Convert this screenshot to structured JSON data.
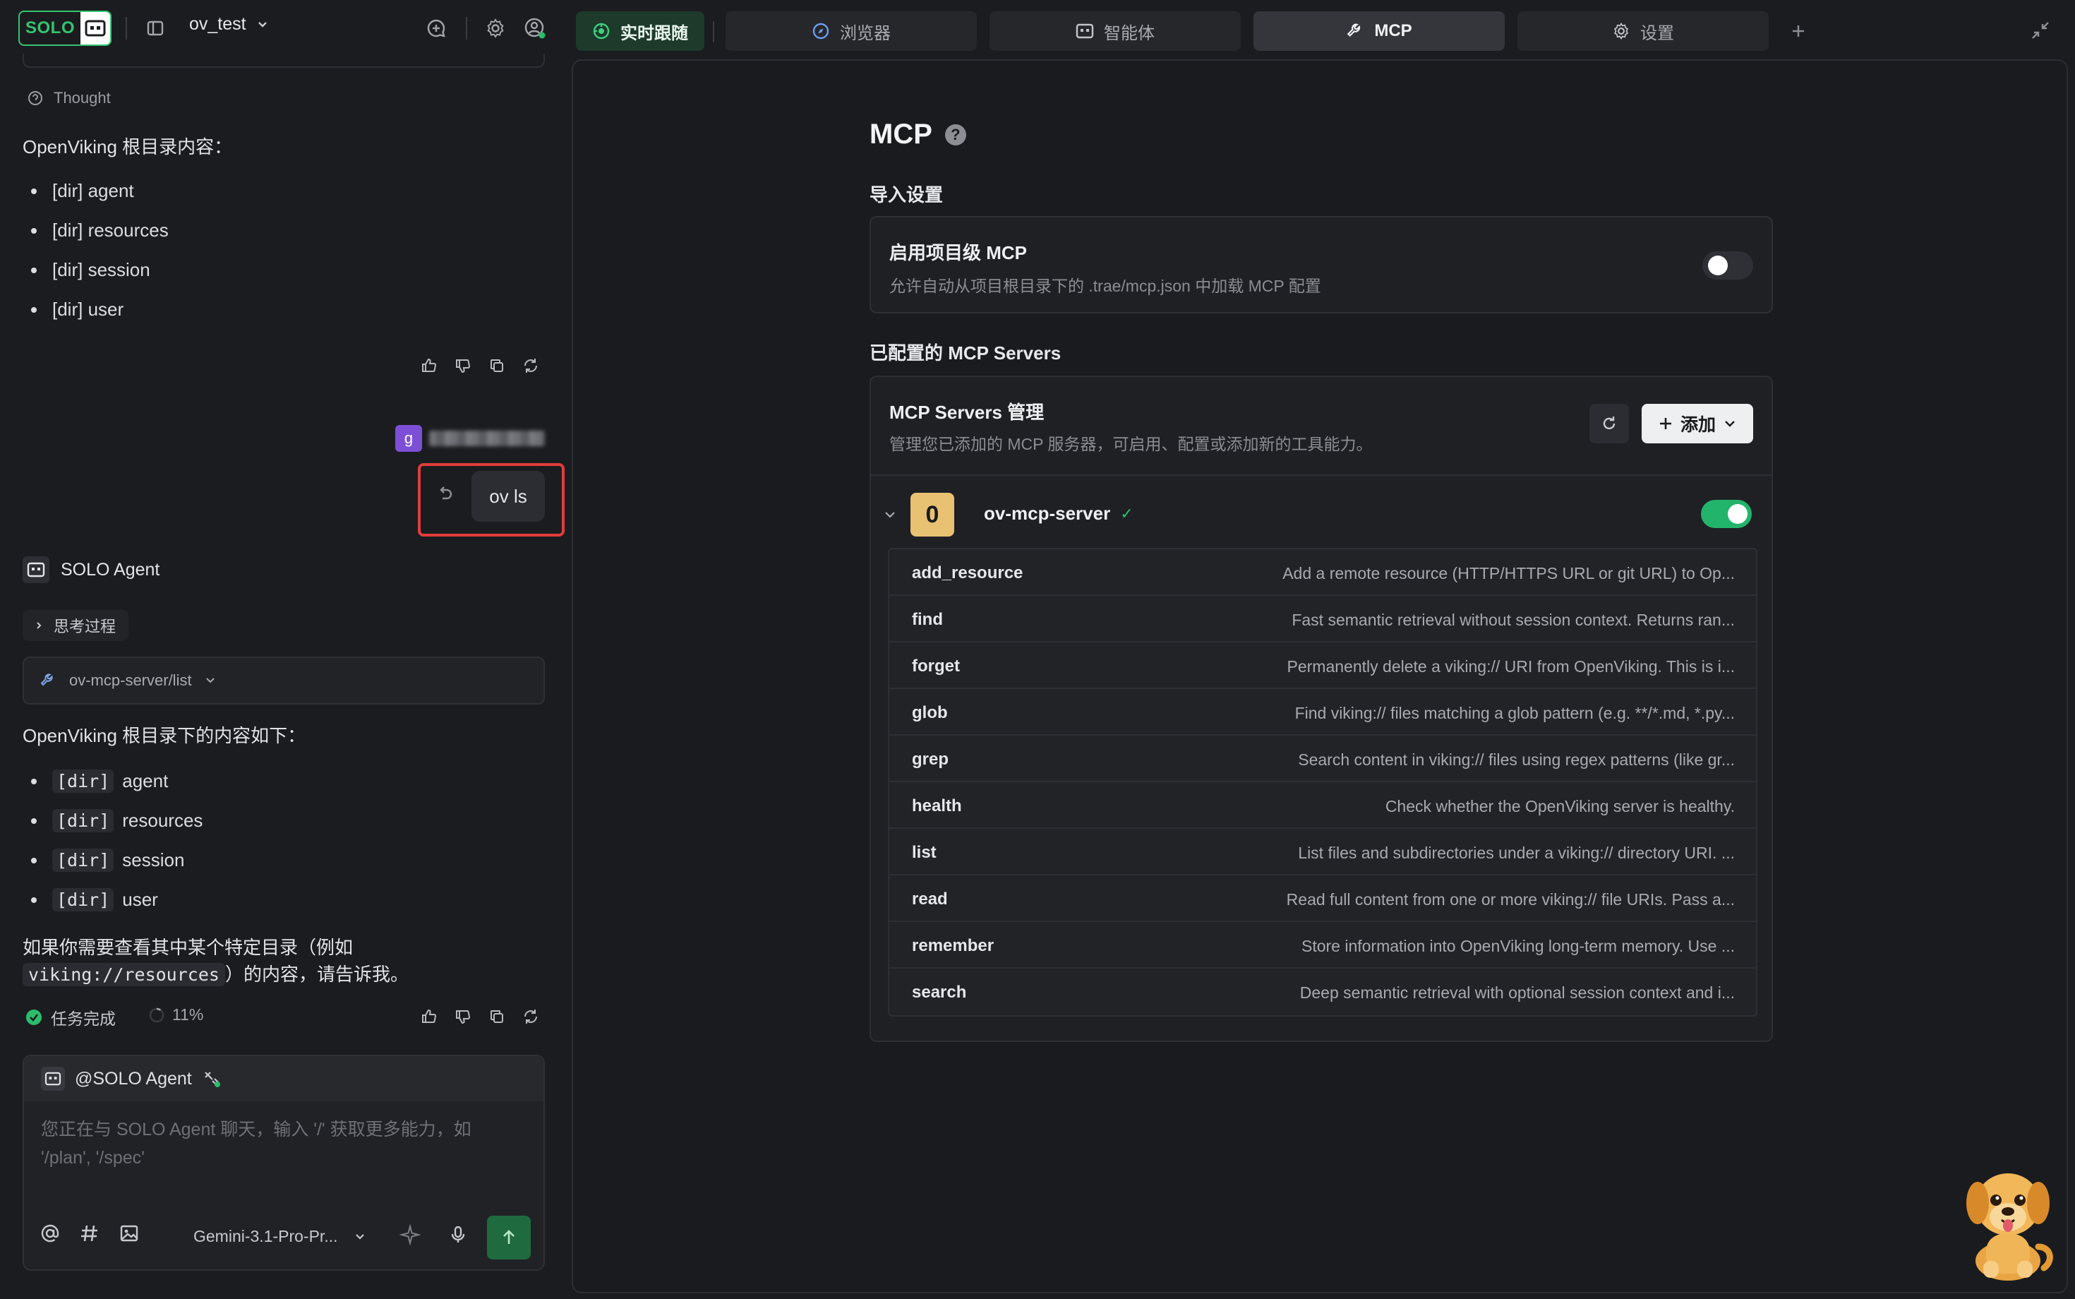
{
  "app": {
    "logo_text": "SOLO",
    "project_name": "ov_test"
  },
  "chat": {
    "thought_label": "Thought",
    "first_heading": "OpenViking 根目录内容：",
    "first_items": [
      "[dir] agent",
      "[dir] resources",
      "[dir] session",
      "[dir] user"
    ],
    "user_avatar_letter": "g",
    "user_message": "ov ls",
    "agent_name": "SOLO Agent",
    "thinking_label": "思考过程",
    "tool_call": "ov-mcp-server/list",
    "answer_heading": "OpenViking 根目录下的内容如下：",
    "answer_items": [
      {
        "tag": "[dir]",
        "name": "agent"
      },
      {
        "tag": "[dir]",
        "name": "resources"
      },
      {
        "tag": "[dir]",
        "name": "session"
      },
      {
        "tag": "[dir]",
        "name": "user"
      }
    ],
    "answer_tail_1": "如果你需要查看其中某个特定目录（例如",
    "answer_tail_code": "viking://resources",
    "answer_tail_2": "）的内容，请告诉我。",
    "task_status": "任务完成",
    "context_usage": "11%"
  },
  "composer": {
    "mention": "@SOLO Agent",
    "placeholder": "您正在与 SOLO Agent 聊天，输入 '/' 获取更多能力，如 '/plan', '/spec'",
    "model": "Gemini-3.1-Pro-Pr..."
  },
  "tabs": [
    {
      "label": "实时跟随",
      "icon": "live-follow-icon"
    },
    {
      "label": "浏览器",
      "icon": "compass-icon"
    },
    {
      "label": "智能体",
      "icon": "agent-icon"
    },
    {
      "label": "MCP",
      "icon": "wrench-icon"
    },
    {
      "label": "设置",
      "icon": "gear-icon"
    }
  ],
  "active_tab": "MCP",
  "mcp": {
    "title": "MCP",
    "import_section": "导入设置",
    "project_mcp_title": "启用项目级 MCP",
    "project_mcp_desc": "允许自动从项目根目录下的 .trae/mcp.json 中加载 MCP 配置",
    "project_mcp_enabled": false,
    "configured_section": "已配置的 MCP Servers",
    "manage_title": "MCP Servers 管理",
    "manage_desc": "管理您已添加的 MCP 服务器，可启用、配置或添加新的工具能力。",
    "add_label": "添加",
    "server": {
      "badge": "0",
      "name": "ov-mcp-server",
      "enabled": true,
      "tools": [
        {
          "name": "add_resource",
          "desc": "Add a remote resource (HTTP/HTTPS URL or git URL) to Op..."
        },
        {
          "name": "find",
          "desc": "Fast semantic retrieval without session context. Returns ran..."
        },
        {
          "name": "forget",
          "desc": "Permanently delete a viking:// URI from OpenViking. This is i..."
        },
        {
          "name": "glob",
          "desc": "Find viking:// files matching a glob pattern (e.g. **/*.md, *.py..."
        },
        {
          "name": "grep",
          "desc": "Search content in viking:// files using regex patterns (like gr..."
        },
        {
          "name": "health",
          "desc": "Check whether the OpenViking server is healthy."
        },
        {
          "name": "list",
          "desc": "List files and subdirectories under a viking:// directory URI. ..."
        },
        {
          "name": "read",
          "desc": "Read full content from one or more viking:// file URIs. Pass a..."
        },
        {
          "name": "remember",
          "desc": "Store information into OpenViking long-term memory. Use ..."
        },
        {
          "name": "search",
          "desc": "Deep semantic retrieval with optional session context and i..."
        }
      ]
    }
  },
  "colors": {
    "accent_green": "#34c470",
    "toggle_on": "#23b46b",
    "highlight_red": "#e23c3c",
    "server_badge": "#e8c272"
  }
}
